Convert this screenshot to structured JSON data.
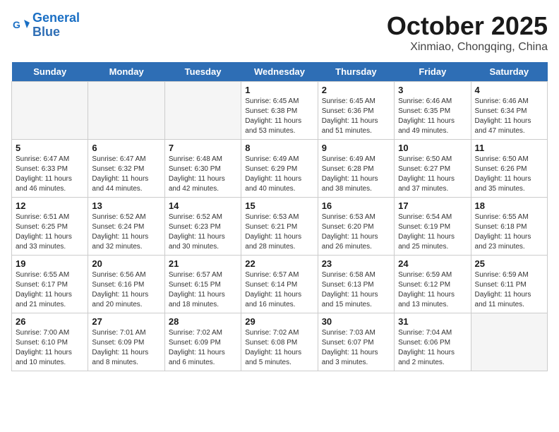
{
  "header": {
    "logo_line1": "General",
    "logo_line2": "Blue",
    "month": "October 2025",
    "location": "Xinmiao, Chongqing, China"
  },
  "weekdays": [
    "Sunday",
    "Monday",
    "Tuesday",
    "Wednesday",
    "Thursday",
    "Friday",
    "Saturday"
  ],
  "weeks": [
    [
      {
        "day": "",
        "info": ""
      },
      {
        "day": "",
        "info": ""
      },
      {
        "day": "",
        "info": ""
      },
      {
        "day": "1",
        "info": "Sunrise: 6:45 AM\nSunset: 6:38 PM\nDaylight: 11 hours\nand 53 minutes."
      },
      {
        "day": "2",
        "info": "Sunrise: 6:45 AM\nSunset: 6:36 PM\nDaylight: 11 hours\nand 51 minutes."
      },
      {
        "day": "3",
        "info": "Sunrise: 6:46 AM\nSunset: 6:35 PM\nDaylight: 11 hours\nand 49 minutes."
      },
      {
        "day": "4",
        "info": "Sunrise: 6:46 AM\nSunset: 6:34 PM\nDaylight: 11 hours\nand 47 minutes."
      }
    ],
    [
      {
        "day": "5",
        "info": "Sunrise: 6:47 AM\nSunset: 6:33 PM\nDaylight: 11 hours\nand 46 minutes."
      },
      {
        "day": "6",
        "info": "Sunrise: 6:47 AM\nSunset: 6:32 PM\nDaylight: 11 hours\nand 44 minutes."
      },
      {
        "day": "7",
        "info": "Sunrise: 6:48 AM\nSunset: 6:30 PM\nDaylight: 11 hours\nand 42 minutes."
      },
      {
        "day": "8",
        "info": "Sunrise: 6:49 AM\nSunset: 6:29 PM\nDaylight: 11 hours\nand 40 minutes."
      },
      {
        "day": "9",
        "info": "Sunrise: 6:49 AM\nSunset: 6:28 PM\nDaylight: 11 hours\nand 38 minutes."
      },
      {
        "day": "10",
        "info": "Sunrise: 6:50 AM\nSunset: 6:27 PM\nDaylight: 11 hours\nand 37 minutes."
      },
      {
        "day": "11",
        "info": "Sunrise: 6:50 AM\nSunset: 6:26 PM\nDaylight: 11 hours\nand 35 minutes."
      }
    ],
    [
      {
        "day": "12",
        "info": "Sunrise: 6:51 AM\nSunset: 6:25 PM\nDaylight: 11 hours\nand 33 minutes."
      },
      {
        "day": "13",
        "info": "Sunrise: 6:52 AM\nSunset: 6:24 PM\nDaylight: 11 hours\nand 32 minutes."
      },
      {
        "day": "14",
        "info": "Sunrise: 6:52 AM\nSunset: 6:23 PM\nDaylight: 11 hours\nand 30 minutes."
      },
      {
        "day": "15",
        "info": "Sunrise: 6:53 AM\nSunset: 6:21 PM\nDaylight: 11 hours\nand 28 minutes."
      },
      {
        "day": "16",
        "info": "Sunrise: 6:53 AM\nSunset: 6:20 PM\nDaylight: 11 hours\nand 26 minutes."
      },
      {
        "day": "17",
        "info": "Sunrise: 6:54 AM\nSunset: 6:19 PM\nDaylight: 11 hours\nand 25 minutes."
      },
      {
        "day": "18",
        "info": "Sunrise: 6:55 AM\nSunset: 6:18 PM\nDaylight: 11 hours\nand 23 minutes."
      }
    ],
    [
      {
        "day": "19",
        "info": "Sunrise: 6:55 AM\nSunset: 6:17 PM\nDaylight: 11 hours\nand 21 minutes."
      },
      {
        "day": "20",
        "info": "Sunrise: 6:56 AM\nSunset: 6:16 PM\nDaylight: 11 hours\nand 20 minutes."
      },
      {
        "day": "21",
        "info": "Sunrise: 6:57 AM\nSunset: 6:15 PM\nDaylight: 11 hours\nand 18 minutes."
      },
      {
        "day": "22",
        "info": "Sunrise: 6:57 AM\nSunset: 6:14 PM\nDaylight: 11 hours\nand 16 minutes."
      },
      {
        "day": "23",
        "info": "Sunrise: 6:58 AM\nSunset: 6:13 PM\nDaylight: 11 hours\nand 15 minutes."
      },
      {
        "day": "24",
        "info": "Sunrise: 6:59 AM\nSunset: 6:12 PM\nDaylight: 11 hours\nand 13 minutes."
      },
      {
        "day": "25",
        "info": "Sunrise: 6:59 AM\nSunset: 6:11 PM\nDaylight: 11 hours\nand 11 minutes."
      }
    ],
    [
      {
        "day": "26",
        "info": "Sunrise: 7:00 AM\nSunset: 6:10 PM\nDaylight: 11 hours\nand 10 minutes."
      },
      {
        "day": "27",
        "info": "Sunrise: 7:01 AM\nSunset: 6:09 PM\nDaylight: 11 hours\nand 8 minutes."
      },
      {
        "day": "28",
        "info": "Sunrise: 7:02 AM\nSunset: 6:09 PM\nDaylight: 11 hours\nand 6 minutes."
      },
      {
        "day": "29",
        "info": "Sunrise: 7:02 AM\nSunset: 6:08 PM\nDaylight: 11 hours\nand 5 minutes."
      },
      {
        "day": "30",
        "info": "Sunrise: 7:03 AM\nSunset: 6:07 PM\nDaylight: 11 hours\nand 3 minutes."
      },
      {
        "day": "31",
        "info": "Sunrise: 7:04 AM\nSunset: 6:06 PM\nDaylight: 11 hours\nand 2 minutes."
      },
      {
        "day": "",
        "info": ""
      }
    ]
  ]
}
